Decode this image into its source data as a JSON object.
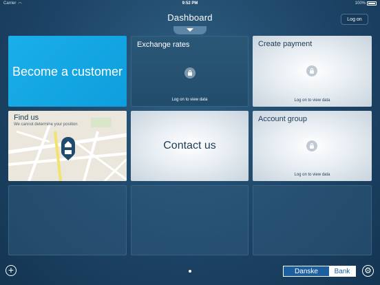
{
  "status_bar": {
    "carrier": "Carrier",
    "time": "9:52 PM",
    "battery": "100%"
  },
  "header": {
    "title": "Dashboard",
    "logon_label": "Log on"
  },
  "tiles": {
    "become_customer": {
      "label": "Become a customer"
    },
    "exchange_rates": {
      "title": "Exchange rates",
      "footer": "Log on to view data"
    },
    "create_payment": {
      "title": "Create payment",
      "footer": "Log on to view data"
    },
    "find_us": {
      "title": "Find us",
      "subtitle": "We cannot determine your position"
    },
    "contact_us": {
      "label": "Contact us"
    },
    "account_group": {
      "title": "Account group",
      "footer": "Log on to view data"
    }
  },
  "footer": {
    "brand_left": "Danske",
    "brand_right": "Bank"
  },
  "colors": {
    "accent": "#0d9fdd",
    "brand_blue": "#1b5fa0",
    "background": "#1d4466"
  },
  "icons": [
    "wifi-icon",
    "lock-icon",
    "chevron-down-icon",
    "home-pin-icon",
    "add-icon",
    "gear-icon"
  ]
}
